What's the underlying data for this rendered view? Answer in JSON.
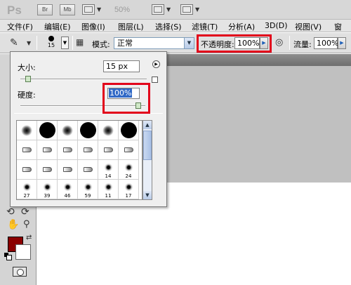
{
  "app": {
    "logo": "Ps",
    "bridge_label": "Br",
    "minibridge_label": "Mb",
    "zoom": "50%"
  },
  "menu": [
    "文件(F)",
    "编辑(E)",
    "图像(I)",
    "图层(L)",
    "选择(S)",
    "滤镜(T)",
    "分析(A)",
    "3D(D)",
    "视图(V)",
    "窗"
  ],
  "options": {
    "brush_size_preview": "15",
    "mode_label": "模式:",
    "mode_value": "正常",
    "opacity_label": "不透明度:",
    "opacity_value": "100%",
    "flow_label": "流量:",
    "flow_value": "100%"
  },
  "brush_panel": {
    "size_label": "大小:",
    "size_value": "15 px",
    "size_level_pct": 6,
    "hardness_label": "硬度:",
    "hardness_value": "100%",
    "hardness_level_pct": 100,
    "presets_row1": [
      "",
      "",
      "",
      "",
      "",
      ""
    ],
    "presets_numbers_row3": [
      "",
      "",
      "",
      "",
      "14",
      "24"
    ],
    "presets_numbers_row4": [
      "27",
      "39",
      "46",
      "59",
      "11",
      "17"
    ]
  },
  "colors": {
    "foreground": "#8b0000",
    "background": "#ffffff",
    "highlight": "#e2001a"
  }
}
